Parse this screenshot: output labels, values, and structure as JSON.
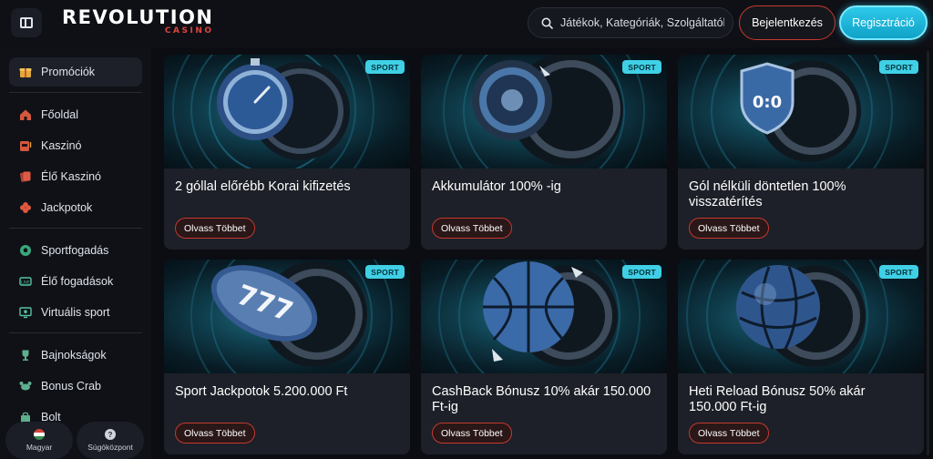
{
  "header": {
    "logo_main": "REVOLUTION",
    "logo_sub": "CASINO",
    "search_placeholder": "Játékok, Kategóriák, Szolgáltatók",
    "login_label": "Bejelentkezés",
    "register_label": "Regisztráció"
  },
  "sidebar": {
    "items": [
      {
        "label": "Promóciók",
        "icon": "gift-icon",
        "active": true
      },
      {
        "label": "Főoldal",
        "icon": "home-icon"
      },
      {
        "label": "Kaszinó",
        "icon": "slot-machine-icon"
      },
      {
        "label": "Élő Kaszinó",
        "icon": "cards-icon"
      },
      {
        "label": "Jackpotok",
        "icon": "clover-icon"
      },
      {
        "label": "Sportfogadás",
        "icon": "football-icon"
      },
      {
        "label": "Élő fogadások",
        "icon": "live-icon"
      },
      {
        "label": "Virtuális sport",
        "icon": "monitor-icon"
      },
      {
        "label": "Bajnokságok",
        "icon": "trophy-icon"
      },
      {
        "label": "Bonus Crab",
        "icon": "crab-icon"
      },
      {
        "label": "Bolt",
        "icon": "shop-icon"
      }
    ],
    "language_label": "Magyar",
    "help_label": "Súgóközpont"
  },
  "promotions": [
    {
      "badge": "SPORT",
      "title": "2 góllal előrébb Korai kifizetés",
      "button": "Olvass Többet",
      "art": "stopwatch"
    },
    {
      "badge": "SPORT",
      "title": "Akkumulátor 100% -ig",
      "button": "Olvass Többet",
      "art": "turbine"
    },
    {
      "badge": "SPORT",
      "title": "Gól nélküli döntetlen 100% visszatérítés",
      "button": "Olvass Többet",
      "art": "shield"
    },
    {
      "badge": "SPORT",
      "title": "Sport Jackpotok 5.200.000 Ft",
      "button": "Olvass Többet",
      "art": "football"
    },
    {
      "badge": "SPORT",
      "title": "CashBack Bónusz 10% akár 150.000 Ft-ig",
      "button": "Olvass Többet",
      "art": "basketball"
    },
    {
      "badge": "SPORT",
      "title": "Heti Reload Bónusz 50% akár 150.000 Ft-ig",
      "button": "Olvass Többet",
      "art": "volleyball"
    }
  ],
  "colors": {
    "accent_red": "#c5392f",
    "accent_cyan": "#2ec9ea",
    "badge": "#3fd0e6"
  }
}
